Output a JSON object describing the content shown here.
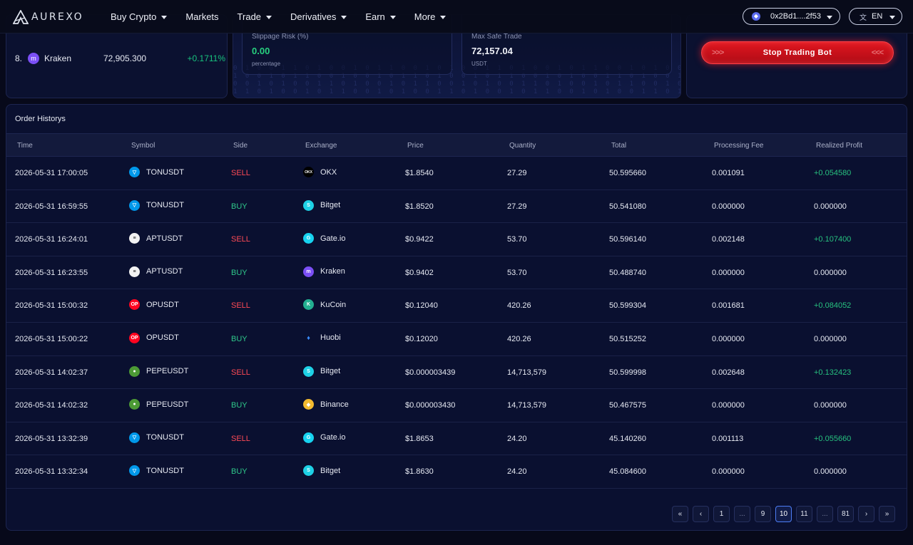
{
  "nav": {
    "brand": "AUREXO",
    "menu": [
      {
        "label": "Buy Crypto",
        "caret": true
      },
      {
        "label": "Markets",
        "caret": false
      },
      {
        "label": "Trade",
        "caret": true
      },
      {
        "label": "Derivatives",
        "caret": true
      },
      {
        "label": "Earn",
        "caret": true
      },
      {
        "label": "More",
        "caret": true
      }
    ],
    "wallet": "0x2Bd1....2f53",
    "language": "EN"
  },
  "ranking": {
    "row": {
      "rank": "8.",
      "name": "Kraken",
      "price": "72,905.300",
      "change": "+0.1711%",
      "icon_color": "#7b4ff5"
    }
  },
  "risk": {
    "slippage": {
      "label": "Slippage Risk (%)",
      "value": "0.00",
      "unit": "percentage"
    },
    "max_safe": {
      "label": "Max Safe Trade",
      "value": "72,157.04",
      "unit": "USDT"
    }
  },
  "bot": {
    "stop_label": "Stop Trading Bot"
  },
  "orders": {
    "title": "Order Historys",
    "columns": [
      "Time",
      "Symbol",
      "Side",
      "Exchange",
      "Price",
      "Quantity",
      "Total",
      "Processing Fee",
      "Realized Profit"
    ],
    "rows": [
      {
        "time": "2026-05-31 17:00:05",
        "symbol": "TONUSDT",
        "side": "SELL",
        "exchange": "OKX",
        "price": "$1.8540",
        "quantity": "27.29",
        "total": "50.595660",
        "fee": "0.001091",
        "profit": "+0.054580"
      },
      {
        "time": "2026-05-31 16:59:55",
        "symbol": "TONUSDT",
        "side": "BUY",
        "exchange": "Bitget",
        "price": "$1.8520",
        "quantity": "27.29",
        "total": "50.541080",
        "fee": "0.000000",
        "profit": "0.000000"
      },
      {
        "time": "2026-05-31 16:24:01",
        "symbol": "APTUSDT",
        "side": "SELL",
        "exchange": "Gate.io",
        "price": "$0.9422",
        "quantity": "53.70",
        "total": "50.596140",
        "fee": "0.002148",
        "profit": "+0.107400"
      },
      {
        "time": "2026-05-31 16:23:55",
        "symbol": "APTUSDT",
        "side": "BUY",
        "exchange": "Kraken",
        "price": "$0.9402",
        "quantity": "53.70",
        "total": "50.488740",
        "fee": "0.000000",
        "profit": "0.000000"
      },
      {
        "time": "2026-05-31 15:00:32",
        "symbol": "OPUSDT",
        "side": "SELL",
        "exchange": "KuCoin",
        "price": "$0.12040",
        "quantity": "420.26",
        "total": "50.599304",
        "fee": "0.001681",
        "profit": "+0.084052"
      },
      {
        "time": "2026-05-31 15:00:22",
        "symbol": "OPUSDT",
        "side": "BUY",
        "exchange": "Huobi",
        "price": "$0.12020",
        "quantity": "420.26",
        "total": "50.515252",
        "fee": "0.000000",
        "profit": "0.000000"
      },
      {
        "time": "2026-05-31 14:02:37",
        "symbol": "PEPEUSDT",
        "side": "SELL",
        "exchange": "Bitget",
        "price": "$0.000003439",
        "quantity": "14,713,579",
        "total": "50.599998",
        "fee": "0.002648",
        "profit": "+0.132423"
      },
      {
        "time": "2026-05-31 14:02:32",
        "symbol": "PEPEUSDT",
        "side": "BUY",
        "exchange": "Binance",
        "price": "$0.000003430",
        "quantity": "14,713,579",
        "total": "50.467575",
        "fee": "0.000000",
        "profit": "0.000000"
      },
      {
        "time": "2026-05-31 13:32:39",
        "symbol": "TONUSDT",
        "side": "SELL",
        "exchange": "Gate.io",
        "price": "$1.8653",
        "quantity": "24.20",
        "total": "45.140260",
        "fee": "0.001113",
        "profit": "+0.055660"
      },
      {
        "time": "2026-05-31 13:32:34",
        "symbol": "TONUSDT",
        "side": "BUY",
        "exchange": "Bitget",
        "price": "$1.8630",
        "quantity": "24.20",
        "total": "45.084600",
        "fee": "0.000000",
        "profit": "0.000000"
      }
    ],
    "pagination": [
      "«",
      "‹",
      "1",
      "...",
      "9",
      "10",
      "11",
      "...",
      "81",
      "›",
      "»"
    ],
    "current_page": "10"
  },
  "colors": {
    "sell": "#ff4a55",
    "buy": "#2fc88a",
    "profit": "#27c17f",
    "stop_button": "#e0161f",
    "page_active": "#4d7df5"
  },
  "symbol_icons": {
    "TONUSDT": {
      "icon": "ton-icon",
      "color": "#0098ea",
      "glyph": "▽"
    },
    "APTUSDT": {
      "icon": "aptos-icon",
      "color": "#f2f2f2",
      "glyph": "≡"
    },
    "OPUSDT": {
      "icon": "optimism-icon",
      "color": "#ff0420",
      "glyph": "OP"
    },
    "PEPEUSDT": {
      "icon": "pepe-icon",
      "color": "#4c9a35",
      "glyph": "●"
    }
  },
  "exchange_icons": {
    "OKX": {
      "icon": "okx-icon",
      "color": "#000000",
      "glyph": "OKX"
    },
    "Bitget": {
      "icon": "bitget-icon",
      "color": "#1ed1e6",
      "glyph": "S"
    },
    "Gate.io": {
      "icon": "gateio-icon",
      "color": "#17d3f0",
      "glyph": "G"
    },
    "Kraken": {
      "icon": "kraken-icon",
      "color": "#7b4ff5",
      "glyph": "m"
    },
    "KuCoin": {
      "icon": "kucoin-icon",
      "color": "#23af91",
      "glyph": "K"
    },
    "Huobi": {
      "icon": "huobi-icon",
      "color": "#0a1030",
      "glyph": "♦"
    },
    "Binance": {
      "icon": "binance-icon",
      "color": "#f3ba2f",
      "glyph": "◆"
    }
  }
}
